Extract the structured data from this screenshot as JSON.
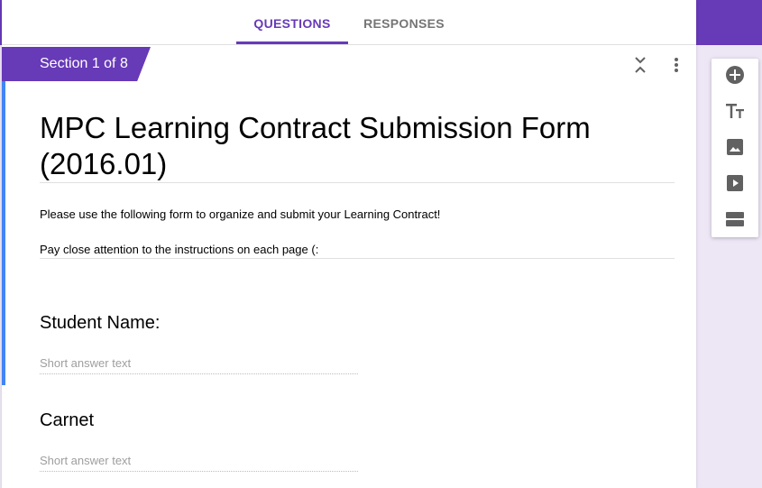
{
  "tabs": [
    {
      "label": "QUESTIONS",
      "active": true
    },
    {
      "label": "RESPONSES",
      "active": false
    }
  ],
  "section": {
    "label": "Section 1 of 8"
  },
  "form": {
    "title": "MPC Learning Contract Submission Form (2016.01)",
    "description_lines": [
      "Please use the following form to organize and submit your Learning Contract!",
      "Pay close attention to the instructions on each page (:"
    ]
  },
  "questions": [
    {
      "title": "Student Name:",
      "placeholder": "Short answer text"
    },
    {
      "title": "Carnet",
      "placeholder": "Short answer text"
    }
  ],
  "toolbar": {
    "icons": [
      "add-question-icon",
      "add-title-icon",
      "add-image-icon",
      "add-video-icon",
      "add-section-icon"
    ]
  },
  "colors": {
    "accent": "#673ab7",
    "focus_bar": "#4285f4",
    "page_bg": "#ece6f5"
  }
}
